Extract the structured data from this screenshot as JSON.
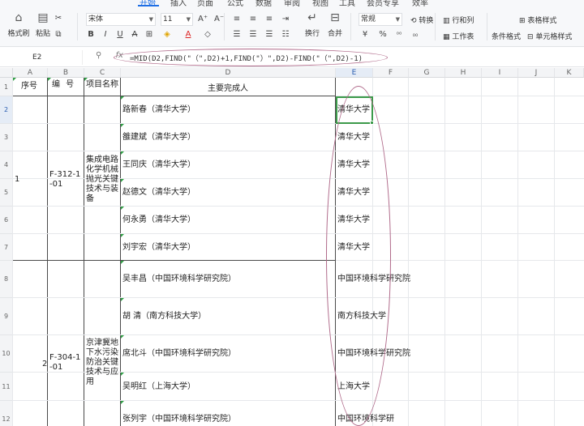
{
  "menu": {
    "tabs": [
      "开始",
      "插入",
      "页面",
      "公式",
      "数据",
      "审阅",
      "视图",
      "工具",
      "会员专享",
      "效率"
    ],
    "active_tab": "开始"
  },
  "ribbon": {
    "format_painter": "格式刷",
    "paste": "粘贴",
    "font_name": "宋体",
    "font_size": "11",
    "font_grow": "A⁺",
    "font_shrink": "A⁻",
    "bold": "B",
    "italic": "I",
    "underline": "U",
    "strike": "A",
    "wrap_text": "换行",
    "merge": "合并",
    "number_format": "常规",
    "convert": "转换",
    "currency": "¥",
    "percent": "%",
    "rows_cols": "行和列",
    "worksheet": "工作表",
    "table_style": "表格样式",
    "conditional_format": "条件格式",
    "cell_style": "单元格样式"
  },
  "formula_bar": {
    "cell_ref": "E2",
    "fx": "fx",
    "formula": "=MID(D2,FIND(\"（\",D2)+1,FIND(\"）\",D2)-FIND(\"（\",D2)-1)"
  },
  "columns": [
    "A",
    "B",
    "C",
    "D",
    "E",
    "F",
    "G",
    "H",
    "I",
    "J",
    "K"
  ],
  "header_row": {
    "A": "序号",
    "B": "编 号",
    "C": "项目名称",
    "D": "主要完成人"
  },
  "row_numbers": [
    "1",
    "2",
    "3",
    "4",
    "5",
    "6",
    "7",
    "8",
    "9",
    "10",
    "11",
    "12"
  ],
  "groups": [
    {
      "seq": "1",
      "code": "F-312-1-01",
      "project": "集成电路化学机械抛光关键技术与装备"
    },
    {
      "seq": "2",
      "code": "F-304-1-01",
      "project": "京津冀地下水污染防治关键技术与应用"
    }
  ],
  "rows": [
    {
      "d": "路新春（清华大学）",
      "e": "清华大学"
    },
    {
      "d": "雒建斌（清华大学）",
      "e": "清华大学"
    },
    {
      "d": "王同庆（清华大学）",
      "e": "清华大学"
    },
    {
      "d": "赵德文（清华大学）",
      "e": "清华大学"
    },
    {
      "d": "何永勇（清华大学）",
      "e": "清华大学"
    },
    {
      "d": "刘宇宏（清华大学）",
      "e": "清华大学"
    },
    {
      "d": "吴丰昌（中国环境科学研究院）",
      "e": "中国环境科学研究院"
    },
    {
      "d": "胡  清（南方科技大学）",
      "e": "南方科技大学"
    },
    {
      "d": "席北斗（中国环境科学研究院）",
      "e": "中国环境科学研究院"
    },
    {
      "d": "吴明红（上海大学）",
      "e": "上海大学"
    },
    {
      "d": "张列宇（中国环境科学研究院）",
      "e": "中国环境科学研"
    }
  ],
  "colors": {
    "accent": "#1f6fe5",
    "selection": "#3c9a4a",
    "annotation": "#b06a8a"
  }
}
